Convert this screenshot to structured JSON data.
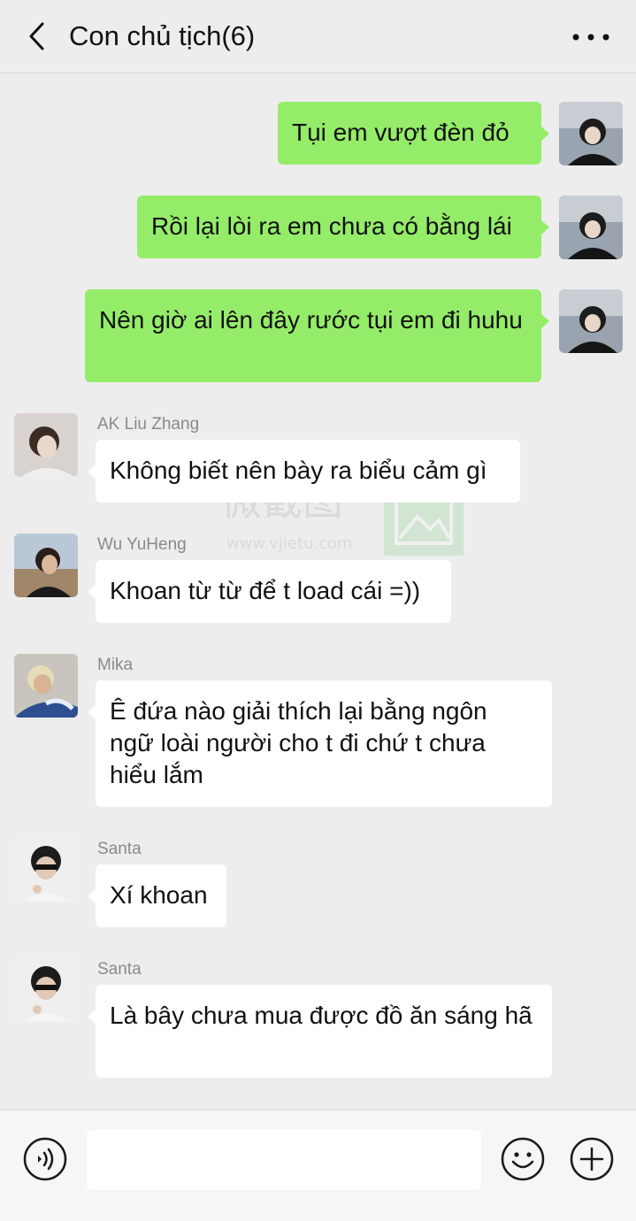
{
  "header": {
    "title": "Con chủ tịch(6)"
  },
  "messages": [
    {
      "from": "me",
      "text": "Tụi em vượt đèn đỏ"
    },
    {
      "from": "me",
      "text": "Rồi lại lòi ra em chưa có bằng lái"
    },
    {
      "from": "me",
      "text": "Nên giờ ai lên đây rước tụi em đi huhu"
    },
    {
      "from": "other",
      "sender": "AK Liu Zhang",
      "text": "Không biết nên bày ra biểu cảm gì"
    },
    {
      "from": "other",
      "sender": "Wu YuHeng",
      "text": "Khoan từ từ để t load cái =))"
    },
    {
      "from": "other",
      "sender": "Mika",
      "text": "Ê đứa nào giải thích lại bằng ngôn ngữ loài người cho t đi chứ t chưa hiểu lắm"
    },
    {
      "from": "other",
      "sender": "Santa",
      "text": "Xí khoan"
    },
    {
      "from": "other",
      "sender": "Santa",
      "text": "Là bây chưa mua được đồ ăn sáng hã"
    }
  ],
  "watermark": {
    "text": "微截图",
    "url": "www.vjietu.com"
  },
  "input": {
    "value": "",
    "placeholder": ""
  },
  "colors": {
    "background": "#ededed",
    "my_bubble": "#95ec69",
    "other_bubble": "#ffffff"
  }
}
